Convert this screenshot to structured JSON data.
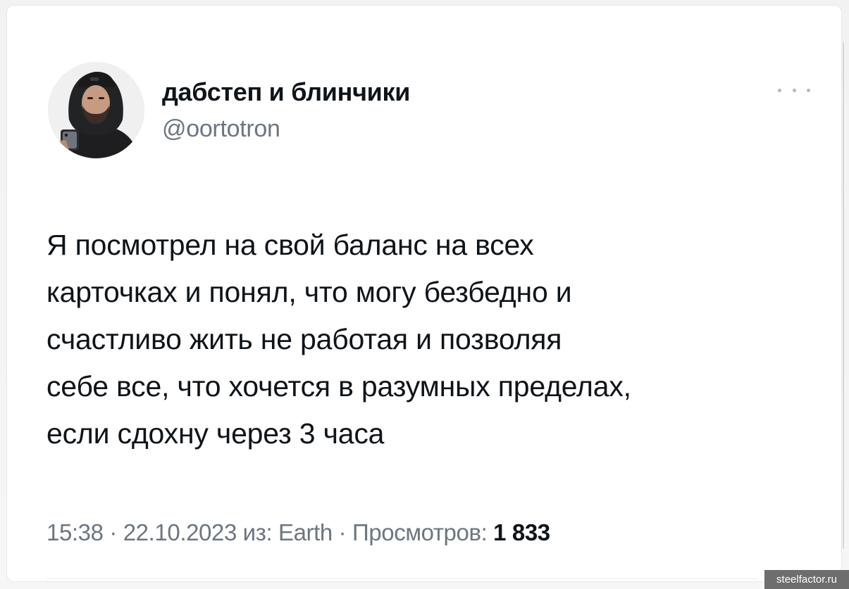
{
  "author": {
    "display_name": "дабстеп и блинчики",
    "handle": "@oortotron"
  },
  "tweet": {
    "lines": [
      "Я посмотрел на свой баланс на всех",
      "карточках и понял, что могу безбедно и",
      "счастливо жить не работая и позволяя",
      "себе все, что хочется в разумных пределах,",
      "если сдохну через 3 часа"
    ]
  },
  "meta": {
    "time": "15:38",
    "sep1": " · ",
    "date": "22.10.2023",
    "source_prefix": " из: ",
    "source": "Earth",
    "sep2": " · ",
    "views_label": "Просмотров: ",
    "views_count": "1 833"
  },
  "watermark": "steelfactor.ru",
  "icons": {
    "more": "more-horizontal-icon"
  },
  "colors": {
    "text_primary": "#0f1419",
    "text_secondary": "#6b7680",
    "background": "#ffffff"
  }
}
